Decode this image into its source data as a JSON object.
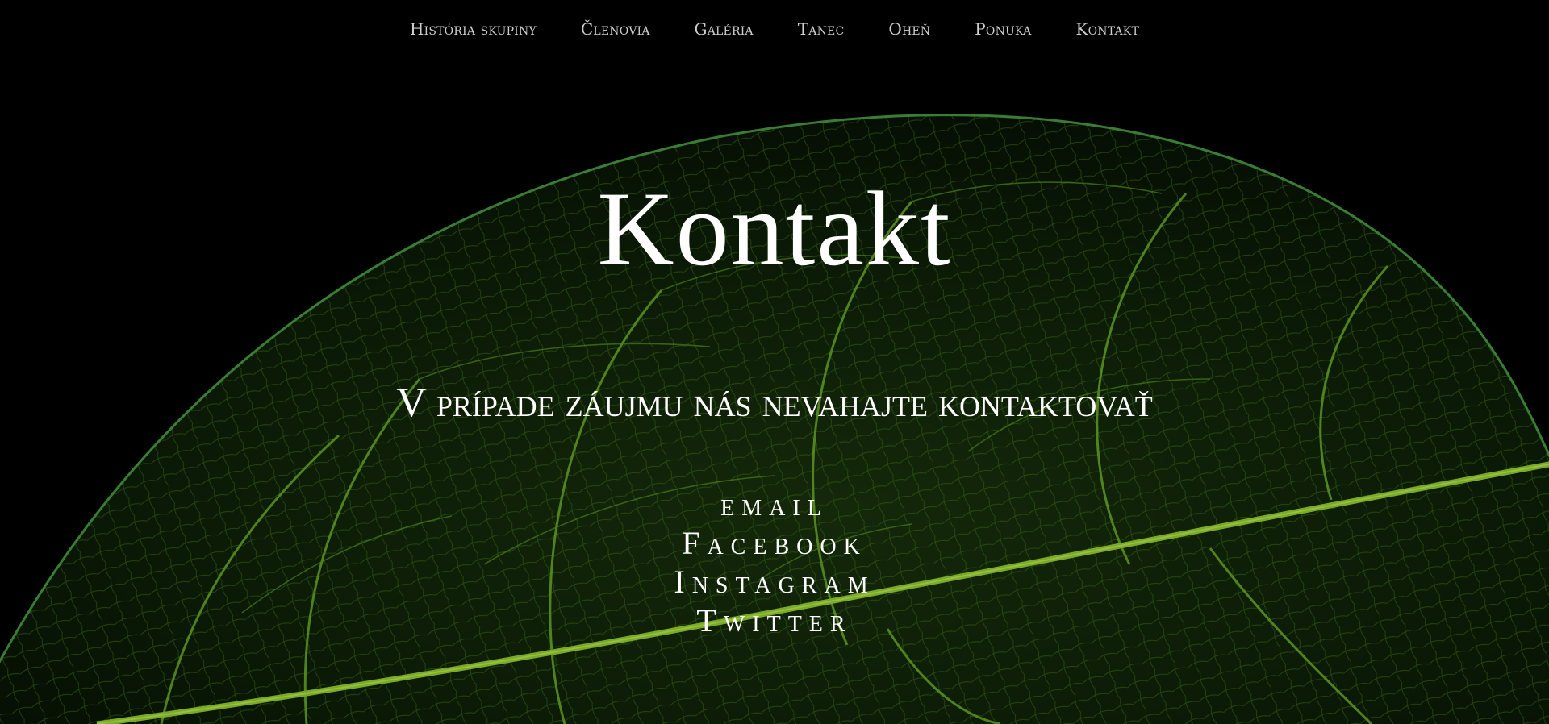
{
  "nav": {
    "items": [
      {
        "label": "História skupiny"
      },
      {
        "label": "Členovia"
      },
      {
        "label": "Galéria"
      },
      {
        "label": "Tanec"
      },
      {
        "label": "Oheň"
      },
      {
        "label": "Ponuka"
      },
      {
        "label": "Kontakt"
      }
    ]
  },
  "hero": {
    "title": "Kontakt",
    "subtitle": "V prípade záujmu nás nevahajte kontaktovať"
  },
  "contact_links": [
    {
      "label": "email"
    },
    {
      "label": "Facebook"
    },
    {
      "label": "Instagram"
    },
    {
      "label": "Twitter"
    }
  ],
  "colors": {
    "background": "#000000",
    "leaf_vein": "#6fa62a",
    "leaf_dark": "#0b1a06",
    "text": "#ffffff",
    "nav_text": "#cfcfcf"
  },
  "background_image": "leaf-vein-icon"
}
